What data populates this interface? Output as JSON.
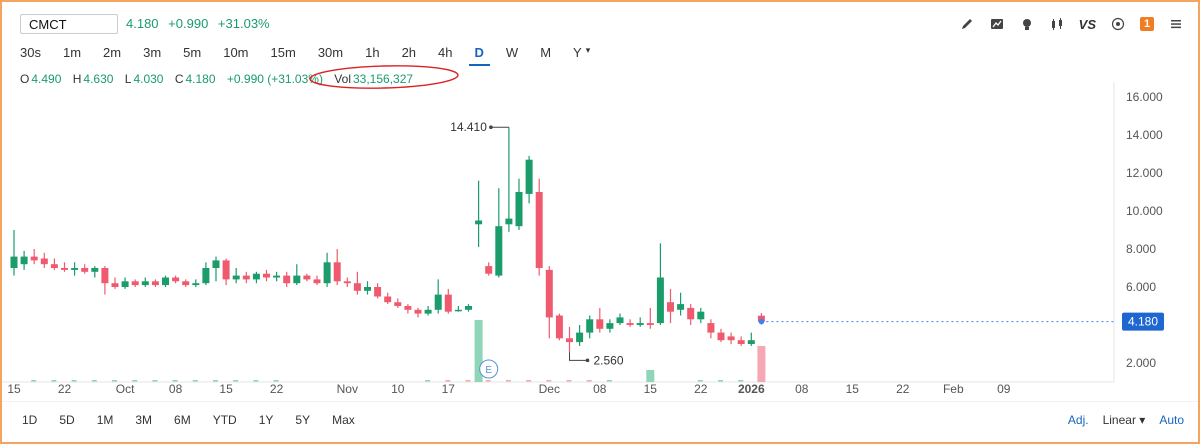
{
  "header": {
    "symbol": "CMCT",
    "last": "4.180",
    "change": "+0.990",
    "change_pct": "+31.03%",
    "accent_up": "#1a9c6b",
    "accent_down": "#f05a6f",
    "toolbar_icons": [
      "pencil-icon",
      "chart-area-icon",
      "lightbulb-icon",
      "candles-icon",
      "compare-icon",
      "settings-icon",
      "notification-icon"
    ],
    "vs_label": "VS",
    "badge": "1"
  },
  "intervals": [
    "30s",
    "1m",
    "2m",
    "3m",
    "5m",
    "10m",
    "15m",
    "30m",
    "1h",
    "2h",
    "4h",
    "D",
    "W",
    "M",
    "Y"
  ],
  "active_interval": "D",
  "ohlc": {
    "o_label": "O",
    "o": "4.490",
    "h_label": "H",
    "h": "4.630",
    "l_label": "L",
    "l": "4.030",
    "c_label": "C",
    "c": "4.180",
    "chg": "+0.990 (+31.03%)",
    "vol_label": "Vol",
    "vol": "33,156,327"
  },
  "ranges": [
    "1D",
    "5D",
    "1M",
    "3M",
    "6M",
    "YTD",
    "1Y",
    "5Y",
    "Max"
  ],
  "footer": {
    "adj": "Adj.",
    "scale": "Linear",
    "auto": "Auto"
  },
  "chart_data": {
    "type": "candlestick",
    "ylim": [
      1.5,
      16.5
    ],
    "y_ticks": [
      2,
      4,
      6,
      8,
      10,
      12,
      14,
      16
    ],
    "y_tick_labels": [
      "2.000",
      "4.000",
      "6.000",
      "8.000",
      "10.000",
      "12.000",
      "14.000",
      "16.000"
    ],
    "x_ticks": [
      {
        "label": "15",
        "i": 0
      },
      {
        "label": "22",
        "i": 5
      },
      {
        "label": "Oct",
        "i": 11
      },
      {
        "label": "08",
        "i": 16
      },
      {
        "label": "15",
        "i": 21
      },
      {
        "label": "22",
        "i": 26
      },
      {
        "label": "Nov",
        "i": 33
      },
      {
        "label": "10",
        "i": 38
      },
      {
        "label": "17",
        "i": 43
      },
      {
        "label": "Dec",
        "i": 53
      },
      {
        "label": "08",
        "i": 58
      },
      {
        "label": "15",
        "i": 63
      },
      {
        "label": "22",
        "i": 68
      },
      {
        "label": "2026",
        "i": 73
      },
      {
        "label": "08",
        "i": 78
      },
      {
        "label": "15",
        "i": 83
      },
      {
        "label": "22",
        "i": 88
      },
      {
        "label": "Feb",
        "i": 93
      },
      {
        "label": "09",
        "i": 98
      }
    ],
    "candles": [
      {
        "o": 7.0,
        "h": 9.0,
        "l": 6.6,
        "c": 7.6
      },
      {
        "o": 7.2,
        "h": 7.9,
        "l": 6.9,
        "c": 7.6
      },
      {
        "o": 7.6,
        "h": 8.0,
        "l": 7.2,
        "c": 7.4
      },
      {
        "o": 7.5,
        "h": 7.8,
        "l": 7.0,
        "c": 7.2
      },
      {
        "o": 7.2,
        "h": 7.5,
        "l": 6.9,
        "c": 7.0
      },
      {
        "o": 7.0,
        "h": 7.3,
        "l": 6.8,
        "c": 6.9
      },
      {
        "o": 6.9,
        "h": 7.3,
        "l": 6.6,
        "c": 7.0
      },
      {
        "o": 7.0,
        "h": 7.2,
        "l": 6.7,
        "c": 6.8
      },
      {
        "o": 6.8,
        "h": 7.1,
        "l": 6.5,
        "c": 7.0
      },
      {
        "o": 7.0,
        "h": 7.1,
        "l": 5.6,
        "c": 6.2
      },
      {
        "o": 6.2,
        "h": 6.5,
        "l": 5.9,
        "c": 6.0
      },
      {
        "o": 6.0,
        "h": 6.5,
        "l": 5.9,
        "c": 6.3
      },
      {
        "o": 6.3,
        "h": 6.4,
        "l": 6.0,
        "c": 6.1
      },
      {
        "o": 6.1,
        "h": 6.5,
        "l": 6.0,
        "c": 6.3
      },
      {
        "o": 6.3,
        "h": 6.4,
        "l": 6.0,
        "c": 6.1
      },
      {
        "o": 6.1,
        "h": 6.6,
        "l": 6.0,
        "c": 6.5
      },
      {
        "o": 6.5,
        "h": 6.6,
        "l": 6.2,
        "c": 6.3
      },
      {
        "o": 6.3,
        "h": 6.4,
        "l": 6.0,
        "c": 6.1
      },
      {
        "o": 6.1,
        "h": 6.4,
        "l": 6.0,
        "c": 6.2
      },
      {
        "o": 6.2,
        "h": 7.3,
        "l": 6.1,
        "c": 7.0
      },
      {
        "o": 7.0,
        "h": 7.6,
        "l": 6.3,
        "c": 7.4
      },
      {
        "o": 7.4,
        "h": 7.5,
        "l": 6.1,
        "c": 6.4
      },
      {
        "o": 6.4,
        "h": 7.0,
        "l": 6.2,
        "c": 6.6
      },
      {
        "o": 6.6,
        "h": 6.8,
        "l": 6.2,
        "c": 6.4
      },
      {
        "o": 6.4,
        "h": 6.8,
        "l": 6.2,
        "c": 6.7
      },
      {
        "o": 6.7,
        "h": 6.9,
        "l": 6.3,
        "c": 6.5
      },
      {
        "o": 6.5,
        "h": 6.8,
        "l": 6.3,
        "c": 6.6
      },
      {
        "o": 6.6,
        "h": 6.8,
        "l": 6.0,
        "c": 6.2
      },
      {
        "o": 6.2,
        "h": 7.2,
        "l": 6.1,
        "c": 6.6
      },
      {
        "o": 6.6,
        "h": 6.7,
        "l": 6.3,
        "c": 6.4
      },
      {
        "o": 6.4,
        "h": 6.6,
        "l": 6.1,
        "c": 6.2
      },
      {
        "o": 6.2,
        "h": 7.8,
        "l": 6.0,
        "c": 7.3
      },
      {
        "o": 7.3,
        "h": 8.0,
        "l": 6.1,
        "c": 6.3
      },
      {
        "o": 6.3,
        "h": 6.5,
        "l": 6.0,
        "c": 6.2
      },
      {
        "o": 6.2,
        "h": 6.8,
        "l": 5.6,
        "c": 5.8
      },
      {
        "o": 5.8,
        "h": 6.3,
        "l": 5.6,
        "c": 6.0
      },
      {
        "o": 6.0,
        "h": 6.2,
        "l": 5.4,
        "c": 5.5
      },
      {
        "o": 5.5,
        "h": 5.7,
        "l": 5.1,
        "c": 5.2
      },
      {
        "o": 5.2,
        "h": 5.4,
        "l": 4.9,
        "c": 5.0
      },
      {
        "o": 5.0,
        "h": 5.1,
        "l": 4.6,
        "c": 4.8
      },
      {
        "o": 4.8,
        "h": 4.9,
        "l": 4.4,
        "c": 4.6
      },
      {
        "o": 4.6,
        "h": 5.0,
        "l": 4.5,
        "c": 4.8
      },
      {
        "o": 4.8,
        "h": 6.4,
        "l": 4.6,
        "c": 5.6
      },
      {
        "o": 5.6,
        "h": 5.9,
        "l": 4.6,
        "c": 4.7
      },
      {
        "o": 4.8,
        "h": 5.0,
        "l": 4.7,
        "c": 4.8
      },
      {
        "o": 4.8,
        "h": 5.1,
        "l": 4.7,
        "c": 5.0
      },
      {
        "o": 9.3,
        "h": 11.6,
        "l": 8.1,
        "c": 9.5
      },
      {
        "o": 7.1,
        "h": 7.3,
        "l": 6.6,
        "c": 6.7
      },
      {
        "o": 6.6,
        "h": 11.2,
        "l": 6.5,
        "c": 9.2
      },
      {
        "o": 9.3,
        "h": 14.41,
        "l": 8.9,
        "c": 9.6
      },
      {
        "o": 9.2,
        "h": 11.7,
        "l": 9.0,
        "c": 11.0
      },
      {
        "o": 10.9,
        "h": 12.9,
        "l": 10.4,
        "c": 12.7
      },
      {
        "o": 11.0,
        "h": 11.7,
        "l": 6.6,
        "c": 7.0
      },
      {
        "o": 6.9,
        "h": 7.1,
        "l": 3.3,
        "c": 4.4
      },
      {
        "o": 4.5,
        "h": 4.6,
        "l": 3.2,
        "c": 3.3
      },
      {
        "o": 3.3,
        "h": 3.9,
        "l": 2.56,
        "c": 3.1
      },
      {
        "o": 3.1,
        "h": 4.0,
        "l": 2.9,
        "c": 3.6
      },
      {
        "o": 3.6,
        "h": 4.5,
        "l": 3.3,
        "c": 4.3
      },
      {
        "o": 4.3,
        "h": 4.9,
        "l": 3.6,
        "c": 3.8
      },
      {
        "o": 3.8,
        "h": 4.3,
        "l": 3.6,
        "c": 4.1
      },
      {
        "o": 4.1,
        "h": 4.6,
        "l": 4.0,
        "c": 4.4
      },
      {
        "o": 4.1,
        "h": 4.3,
        "l": 3.9,
        "c": 4.0
      },
      {
        "o": 4.0,
        "h": 4.4,
        "l": 3.9,
        "c": 4.1
      },
      {
        "o": 4.1,
        "h": 4.9,
        "l": 3.8,
        "c": 4.0
      },
      {
        "o": 4.1,
        "h": 8.3,
        "l": 4.0,
        "c": 6.5
      },
      {
        "o": 5.2,
        "h": 5.9,
        "l": 4.1,
        "c": 4.7
      },
      {
        "o": 4.8,
        "h": 5.7,
        "l": 4.5,
        "c": 5.1
      },
      {
        "o": 4.9,
        "h": 5.1,
        "l": 4.0,
        "c": 4.3
      },
      {
        "o": 4.3,
        "h": 4.9,
        "l": 4.1,
        "c": 4.7
      },
      {
        "o": 4.1,
        "h": 4.3,
        "l": 3.3,
        "c": 3.6
      },
      {
        "o": 3.6,
        "h": 3.8,
        "l": 3.1,
        "c": 3.2
      },
      {
        "o": 3.4,
        "h": 3.6,
        "l": 3.0,
        "c": 3.2
      },
      {
        "o": 3.2,
        "h": 3.4,
        "l": 2.9,
        "c": 3.0
      },
      {
        "o": 3.0,
        "h": 3.6,
        "l": 2.9,
        "c": 3.2
      },
      {
        "o": 4.49,
        "h": 4.63,
        "l": 4.03,
        "c": 4.18
      }
    ],
    "volume_spikes": [
      {
        "i": 46,
        "color": "up"
      },
      {
        "i": 63,
        "color": "up"
      },
      {
        "i": 74,
        "color": "down"
      }
    ],
    "annotations": {
      "high_label": "14.410",
      "high_index": 49,
      "low_label": "2.560",
      "low_index": 55,
      "last_price_label": "4.180",
      "last_price": 4.18,
      "event_marker": "E",
      "event_index": 47
    }
  }
}
